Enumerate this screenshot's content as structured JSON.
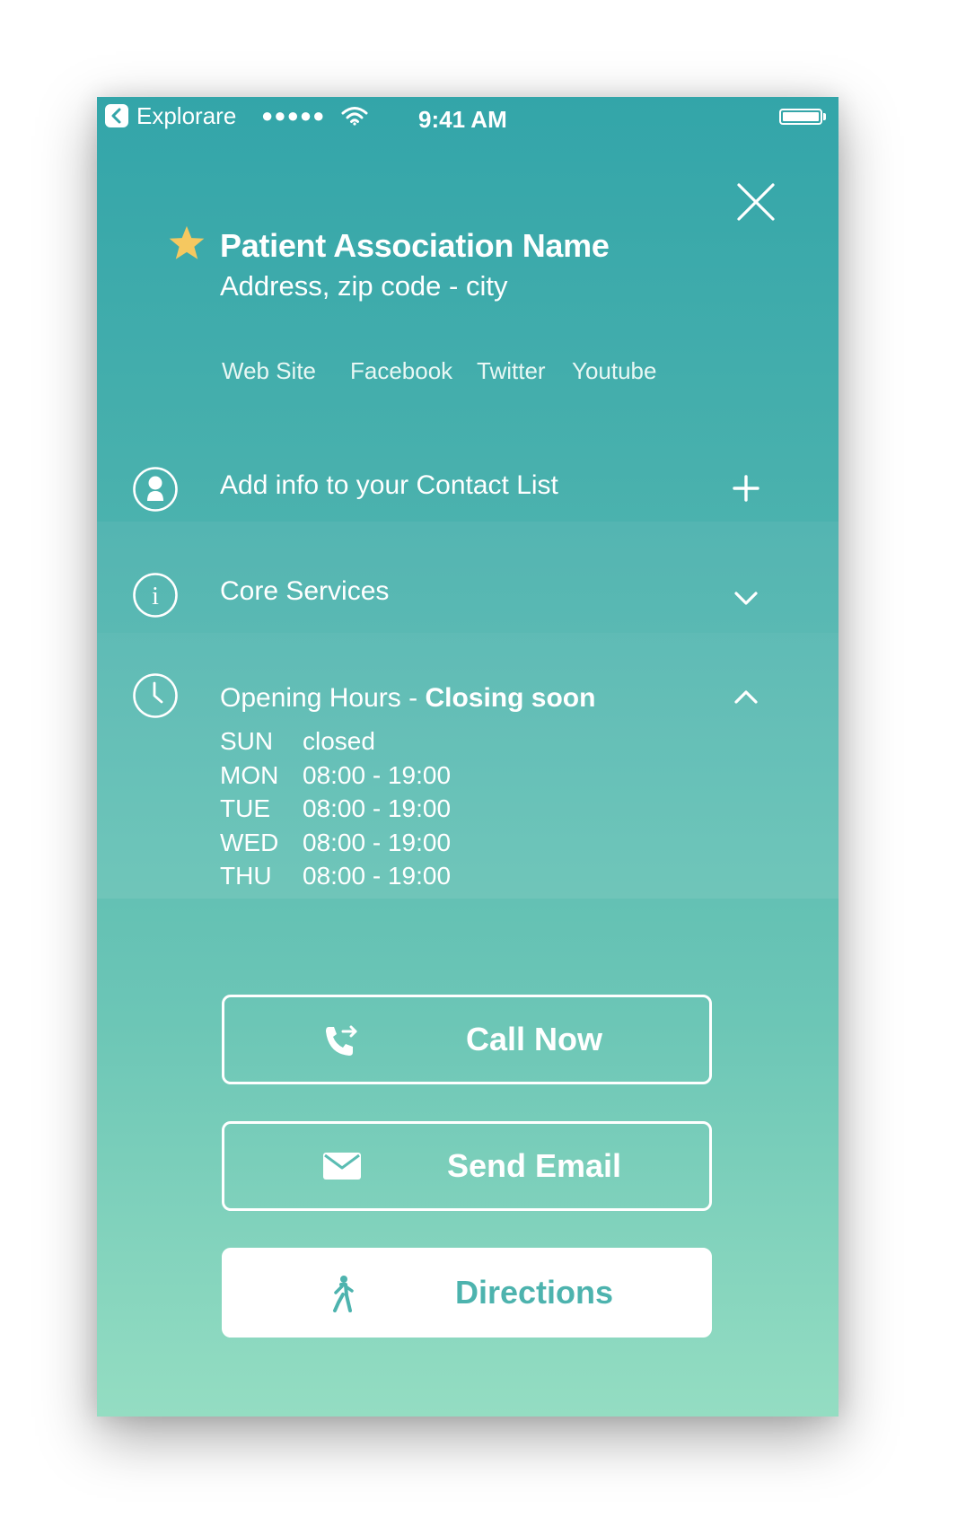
{
  "status_bar": {
    "back_label": "Explorare",
    "signal": "●●●●●",
    "time": "9:41 AM"
  },
  "header": {
    "title": "Patient Association Name",
    "address": "Address, zip code - city",
    "links": [
      "Web Site",
      "Facebook",
      "Twitter",
      "Youtube"
    ]
  },
  "sections": {
    "contact": {
      "label": "Add info to your Contact List"
    },
    "services": {
      "label": "Core Services"
    },
    "hours": {
      "label": "Opening Hours - ",
      "status": "Closing soon",
      "schedule": [
        {
          "day": "SUN",
          "time": "closed"
        },
        {
          "day": "MON",
          "time": "08:00 - 19:00"
        },
        {
          "day": "TUE",
          "time": "08:00 - 19:00"
        },
        {
          "day": "WED",
          "time": "08:00 - 19:00"
        },
        {
          "day": "THU",
          "time": "08:00 - 19:00"
        }
      ]
    }
  },
  "actions": {
    "call": "Call Now",
    "email": "Send Email",
    "directions": "Directions"
  },
  "colors": {
    "gradient_top": "#33a5a9",
    "gradient_bottom": "#94ddc2",
    "star": "#f5c860",
    "directions_text": "#4db3ae"
  },
  "icons": {
    "back": "back-chevron-icon",
    "wifi": "wifi-icon",
    "close": "close-icon",
    "star": "star-icon",
    "contact": "person-icon",
    "services": "info-icon",
    "hours": "clock-icon",
    "add": "plus-icon",
    "expand": "chevron-down-icon",
    "collapse": "chevron-up-icon",
    "call": "phone-icon",
    "email": "envelope-icon",
    "directions": "walking-icon"
  }
}
